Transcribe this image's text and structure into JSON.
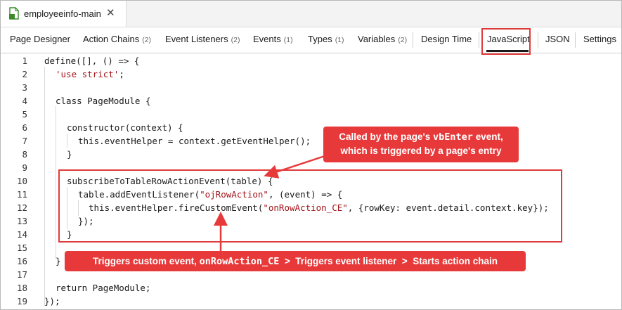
{
  "file_tab": {
    "name": "employeeinfo-main",
    "close": "✕"
  },
  "tabs": [
    {
      "label": "Page Designer",
      "count": ""
    },
    {
      "label": "Action Chains",
      "count": "(2)"
    },
    {
      "label": "Event Listeners",
      "count": "(2)"
    },
    {
      "label": "Events",
      "count": "(1)"
    },
    {
      "label": "Types",
      "count": "(1)"
    },
    {
      "label": "Variables",
      "count": "(2)"
    },
    {
      "label": "Design Time",
      "count": ""
    },
    {
      "label": "JavaScript",
      "count": ""
    },
    {
      "label": "JSON",
      "count": ""
    },
    {
      "label": "Settings",
      "count": ""
    }
  ],
  "active_tab": "JavaScript",
  "code": {
    "line_numbers": [
      "1",
      "2",
      "3",
      "4",
      "5",
      "6",
      "7",
      "8",
      "9",
      "10",
      "11",
      "12",
      "13",
      "14",
      "15",
      "16",
      "17",
      "18",
      "19"
    ],
    "lines": {
      "l1": "define([], () => {",
      "l2a": "'use strict'",
      "l2b": ";",
      "l4a": "class ",
      "l4b": "PageModule",
      "l4c": " {",
      "l6a": "constructor",
      "l6b": "(context) {",
      "l7": "this.eventHelper = context.getEventHelper();",
      "l8": "}",
      "l10": "subscribeToTableRowActionEvent(table) {",
      "l11a": "table.addEventListener(",
      "l11b": "\"ojRowAction\"",
      "l11c": ", (event) => {",
      "l12a": "this.eventHelper.fireCustomEvent(",
      "l12b": "\"onRowAction_CE\"",
      "l12c": ", {rowKey: event.detail.context.key});",
      "l13": "});",
      "l14": "}",
      "l16": "}",
      "l18": "return PageModule;",
      "l19": "});"
    }
  },
  "annotations": {
    "top_line1_a": "Called by the page's ",
    "top_line1_code": "vbEnter",
    "top_line1_b": " event,",
    "top_line2": "which is triggered by a page's entry",
    "bottom_a": "Triggers custom event, ",
    "bottom_code": "onRowAction_CE",
    "bottom_b": "  >  Triggers event listener  >  Starts action chain"
  },
  "colors": {
    "highlight": "#e03b3b",
    "callout_bg": "#e8393a",
    "string": "#a3151a",
    "file_icon": "#3a8a2a"
  }
}
